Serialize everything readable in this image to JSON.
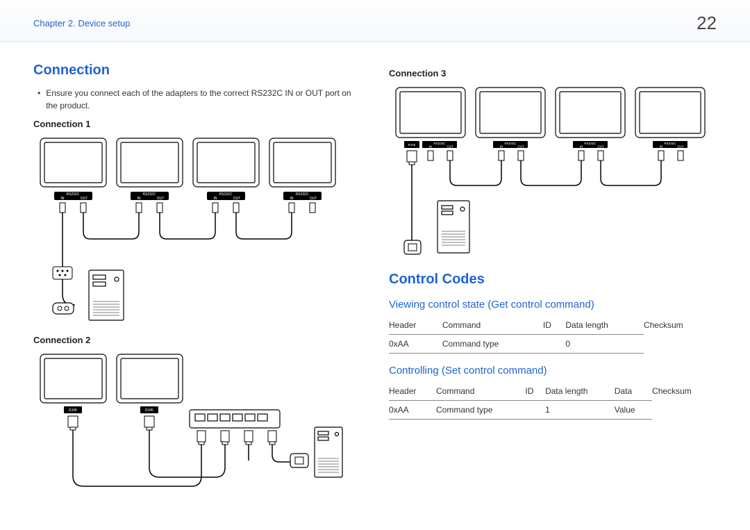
{
  "header": {
    "chapter": "Chapter 2. Device setup",
    "page": "22"
  },
  "left": {
    "title": "Connection",
    "bullet": "Ensure you connect each of the adapters to the correct RS232C IN or OUT port on the product.",
    "conn1": "Connection 1",
    "conn2": "Connection 2",
    "labels": {
      "rs232c": "RS232C",
      "in": "IN",
      "out": "OUT",
      "rj45": "RJ45"
    }
  },
  "right": {
    "conn3": "Connection 3",
    "labels": {
      "rs232c": "RS232C",
      "in": "IN",
      "out": "OUT",
      "rj45": "RJ45"
    },
    "control_title": "Control Codes",
    "get": {
      "title": "Viewing control state (Get control command)",
      "head": [
        "Header",
        "Command",
        "ID",
        "Data length",
        "Checksum"
      ],
      "row": [
        "0xAA",
        "Command type",
        "",
        "0",
        ""
      ]
    },
    "set": {
      "title": "Controlling (Set control command)",
      "head": [
        "Header",
        "Command",
        "ID",
        "Data length",
        "Data",
        "Checksum"
      ],
      "row": [
        "0xAA",
        "Command type",
        "",
        "1",
        "Value",
        ""
      ]
    }
  }
}
